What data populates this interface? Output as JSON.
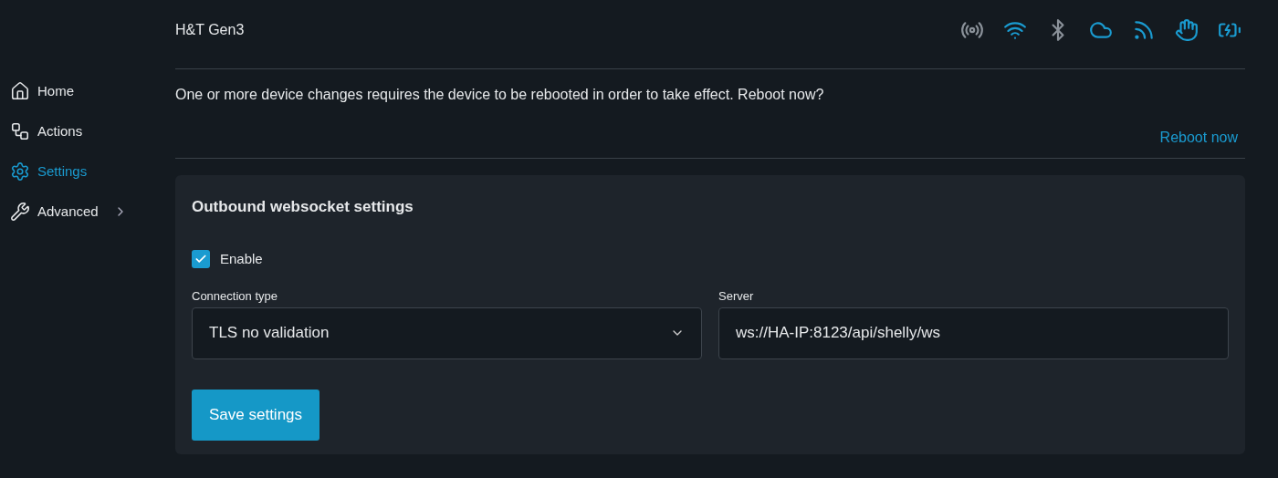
{
  "device_title": "H&T Gen3",
  "status_icons": [
    {
      "kind": "ap",
      "on": false
    },
    {
      "kind": "wifi",
      "on": true
    },
    {
      "kind": "bluetooth",
      "on": false
    },
    {
      "kind": "cloud",
      "on": true
    },
    {
      "kind": "mqtt",
      "on": true
    },
    {
      "kind": "ws",
      "on": true
    },
    {
      "kind": "battery",
      "on": true
    }
  ],
  "sidebar": {
    "items": [
      {
        "kind": "home",
        "label": "Home",
        "selected": false,
        "has_submenu": false
      },
      {
        "kind": "actions",
        "label": "Actions",
        "selected": false,
        "has_submenu": false
      },
      {
        "kind": "settings",
        "label": "Settings",
        "selected": true,
        "has_submenu": false
      },
      {
        "kind": "advanced",
        "label": "Advanced",
        "selected": false,
        "has_submenu": true
      }
    ]
  },
  "notice": {
    "message": "One or more device changes requires the device to be rebooted in order to take effect. Reboot now?",
    "action": "Reboot now"
  },
  "card": {
    "title": "Outbound websocket settings",
    "enable": {
      "label": "Enable",
      "checked": true
    },
    "connection_type": {
      "label": "Connection type",
      "value": "TLS no validation"
    },
    "server": {
      "label": "Server",
      "value": "ws://HA-IP:8123/api/shelly/ws"
    },
    "save_button": "Save settings"
  }
}
